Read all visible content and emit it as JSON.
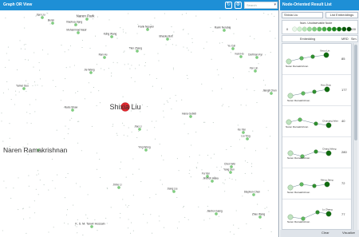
{
  "graph": {
    "title": "Graph OR View",
    "subtitle": "Network node",
    "search_placeholder": "Search",
    "refresh_icon": "refresh-icon",
    "settings_icon": "settings-icon",
    "highlight_color": "#e0262d",
    "node_color": "#7fd07f",
    "nodes": [
      {
        "label": "Jian Liu",
        "size": 4
      },
      {
        "label": "Naren Park",
        "size": 5
      },
      {
        "label": "Renin",
        "size": 3
      },
      {
        "label": "Xiaohua Jiang",
        "size": 3
      },
      {
        "label": "Mohammad Nasir",
        "size": 3
      },
      {
        "label": "Frank Nguyen",
        "size": 3
      },
      {
        "label": "Kang Wang",
        "size": 3
      },
      {
        "label": "Ravin Nerabaj",
        "size": 3
      },
      {
        "label": "Bhaska Bolt",
        "size": 3
      },
      {
        "label": "Tien Zhang",
        "size": 3
      },
      {
        "label": "Ran Hu",
        "size": 3
      },
      {
        "label": "Dorfman Kyi",
        "size": 3
      },
      {
        "label": "Yu Cai",
        "size": 3
      },
      {
        "label": "Ivan Ho",
        "size": 3
      },
      {
        "label": "Jie Wang",
        "size": 3
      },
      {
        "label": "Yen Lin",
        "size": 3
      },
      {
        "label": "Jiangli Chen",
        "size": 3
      },
      {
        "label": "Yamei Guo",
        "size": 3
      },
      {
        "label": "Shixia Liu",
        "size": 8
      },
      {
        "label": "Naren Ramakrishnan",
        "size": 7
      },
      {
        "label": "Nadu Shaw",
        "size": 3
      },
      {
        "label": "Jiao Li",
        "size": 3
      },
      {
        "label": "Hana Gobidi",
        "size": 3
      },
      {
        "label": "Ke Yan",
        "size": 3
      },
      {
        "label": "Liu Ying",
        "size": 3
      },
      {
        "label": "Ying Wong",
        "size": 3
      },
      {
        "label": "Chen Wei",
        "size": 3
      },
      {
        "label": "Yang Sun",
        "size": 3
      },
      {
        "label": "Fa Yan",
        "size": 3
      },
      {
        "label": "Jindrich Alaka",
        "size": 3
      },
      {
        "label": "Stephen Chen",
        "size": 3
      },
      {
        "label": "Jiang Liu",
        "size": 3
      },
      {
        "label": "Jinho Li",
        "size": 3
      },
      {
        "label": "K. S. M. Tanvir Hossain",
        "size": 4
      },
      {
        "label": "Jianbo Huang",
        "size": 3
      },
      {
        "label": "Zhao Wang",
        "size": 3
      }
    ]
  },
  "results": {
    "title": "Node-Oriented Result List",
    "query_value": "Shixia Liu",
    "list_embeddings_label": "List Embeddings",
    "legend_title": "Num. Unobservable Node",
    "legend_low": "0",
    "legend_high": "100",
    "col_embedding": "Embedding",
    "col_mrd": "MRD",
    "col_sim": "Sim.",
    "rows": [
      {
        "mrd": "85",
        "left": "Naren Ramakrishnan",
        "right": "Xinyu Lin"
      },
      {
        "mrd": "177",
        "left": "Naren Ramakrishnan",
        "right": "Hao Zhou"
      },
      {
        "mrd": "40",
        "left": "Naren Ramakrishnan",
        "right": "Chunqing Wang"
      },
      {
        "mrd": "280",
        "left": "Naren Ramakrishnan",
        "right": "Chang Wang"
      },
      {
        "mrd": "72",
        "left": "Naren Ramakrishnan",
        "right": "Meng Jiang"
      },
      {
        "mrd": "77",
        "left": "Naren Ramakrishnan",
        "right": "Lu Zhang"
      }
    ],
    "clear_label": "Clear",
    "visualize_label": "Visualize"
  }
}
